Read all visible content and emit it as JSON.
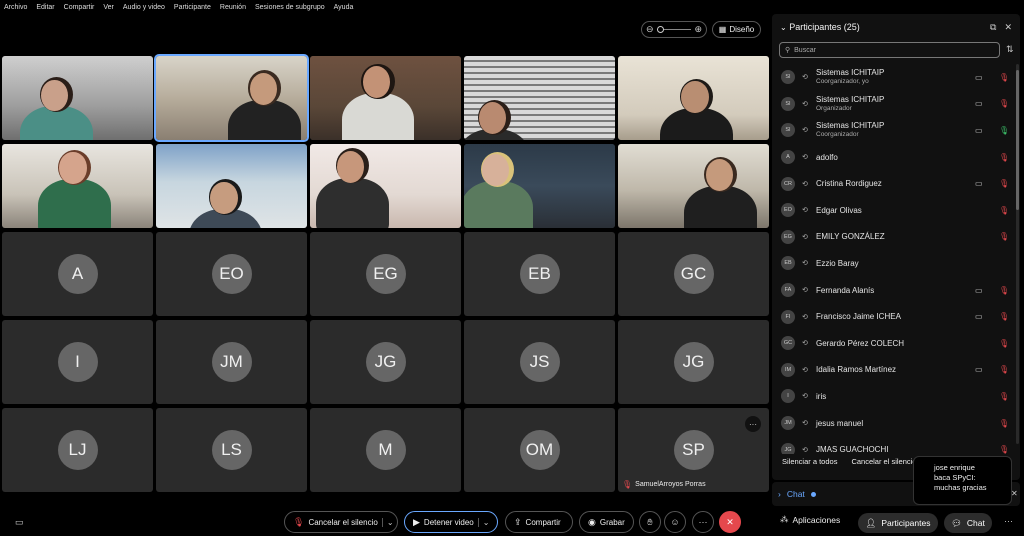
{
  "menu": [
    "Archivo",
    "Editar",
    "Compartir",
    "Ver",
    "Audio y video",
    "Participante",
    "Reunión",
    "Sesiones de subgrupo",
    "Ayuda"
  ],
  "stage_controls": {
    "zoom_minus": "⊖",
    "zoom_plus": "⊕",
    "layout_label": "Diseño"
  },
  "video_tiles": [
    {
      "kind": "video",
      "scene": "woman-headset"
    },
    {
      "kind": "video",
      "scene": "room-presenter",
      "active": true
    },
    {
      "kind": "video",
      "scene": "man-beard"
    },
    {
      "kind": "video",
      "scene": "blinds-woman"
    },
    {
      "kind": "video",
      "scene": "office-man"
    },
    {
      "kind": "video",
      "scene": "woman-smile"
    },
    {
      "kind": "video",
      "scene": "boy-poster"
    },
    {
      "kind": "video",
      "scene": "woman-closeup"
    },
    {
      "kind": "video",
      "scene": "woman-blonde"
    },
    {
      "kind": "video",
      "scene": "room-presenter-2"
    }
  ],
  "avatar_tiles": [
    {
      "initials": "A"
    },
    {
      "initials": "EO"
    },
    {
      "initials": "EG"
    },
    {
      "initials": "EB"
    },
    {
      "initials": "GC"
    },
    {
      "initials": "I"
    },
    {
      "initials": "JM"
    },
    {
      "initials": "JG"
    },
    {
      "initials": "JS"
    },
    {
      "initials": "JG"
    },
    {
      "initials": "LJ"
    },
    {
      "initials": "LS"
    },
    {
      "initials": "M"
    },
    {
      "initials": "OM"
    },
    {
      "initials": "SP",
      "name": "SamuelArroyos Porras",
      "more": "···"
    }
  ],
  "toolbar": {
    "unmute_label": "Cancelar el silencio",
    "stop_video_label": "Detener video",
    "share_label": "Compartir",
    "record_label": "Grabar"
  },
  "participants_panel": {
    "title": "Participantes (25)",
    "search_placeholder": "Buscar",
    "participants": [
      {
        "initials": "SI",
        "name": "Sistemas ICHITAIP",
        "role": "Coorganizador, yo",
        "video": true,
        "mic": "muted"
      },
      {
        "initials": "SI",
        "name": "Sistemas ICHITAIP",
        "role": "Organizador",
        "video": true,
        "mic": "muted"
      },
      {
        "initials": "SI",
        "name": "Sistemas ICHITAIP",
        "role": "Coorganizador",
        "video": true,
        "mic": "on"
      },
      {
        "initials": "A",
        "name": "adolfo",
        "role": "",
        "video": false,
        "mic": "muted"
      },
      {
        "initials": "CR",
        "name": "Cristina Rordiguez",
        "role": "",
        "video": true,
        "mic": "muted"
      },
      {
        "initials": "EO",
        "name": "Edgar Olivas",
        "role": "",
        "video": false,
        "mic": "muted"
      },
      {
        "initials": "EG",
        "name": "EMILY GONZÁLEZ",
        "role": "",
        "video": false,
        "mic": "muted"
      },
      {
        "initials": "EB",
        "name": "Ezzio Baray",
        "role": "",
        "video": false,
        "mic": "none"
      },
      {
        "initials": "FA",
        "name": "Fernanda Alanís",
        "role": "",
        "video": true,
        "mic": "muted"
      },
      {
        "initials": "FI",
        "name": "Francisco Jaime    ICHEA",
        "role": "",
        "video": true,
        "mic": "muted"
      },
      {
        "initials": "GC",
        "name": "Gerardo Pérez COLECH",
        "role": "",
        "video": false,
        "mic": "muted"
      },
      {
        "initials": "IM",
        "name": "Idalia Ramos Martínez",
        "role": "",
        "video": true,
        "mic": "muted"
      },
      {
        "initials": "I",
        "name": "iris",
        "role": "",
        "video": false,
        "mic": "muted"
      },
      {
        "initials": "JM",
        "name": "jesus manuel",
        "role": "",
        "video": false,
        "mic": "muted"
      },
      {
        "initials": "JG",
        "name": "JMAS GUACHOCHI",
        "role": "",
        "video": false,
        "mic": "muted"
      }
    ],
    "mute_all_label": "Silenciar a todos",
    "unmute_all_label": "Cancelar el silencio"
  },
  "chat_strip": {
    "label": "Chat"
  },
  "toast": {
    "lines": [
      "jose enrique",
      "baca SPyCI:",
      "muchas gracias"
    ]
  },
  "bottom_right": {
    "apps_label": "Aplicaciones",
    "participants_label": "Participantes",
    "chat_label": "Chat"
  },
  "colors": {
    "accent": "#6aa8ff",
    "muted_red": "#e5484d",
    "mic_on": "#3cc36b",
    "tile_bg": "#2b2b2b"
  }
}
